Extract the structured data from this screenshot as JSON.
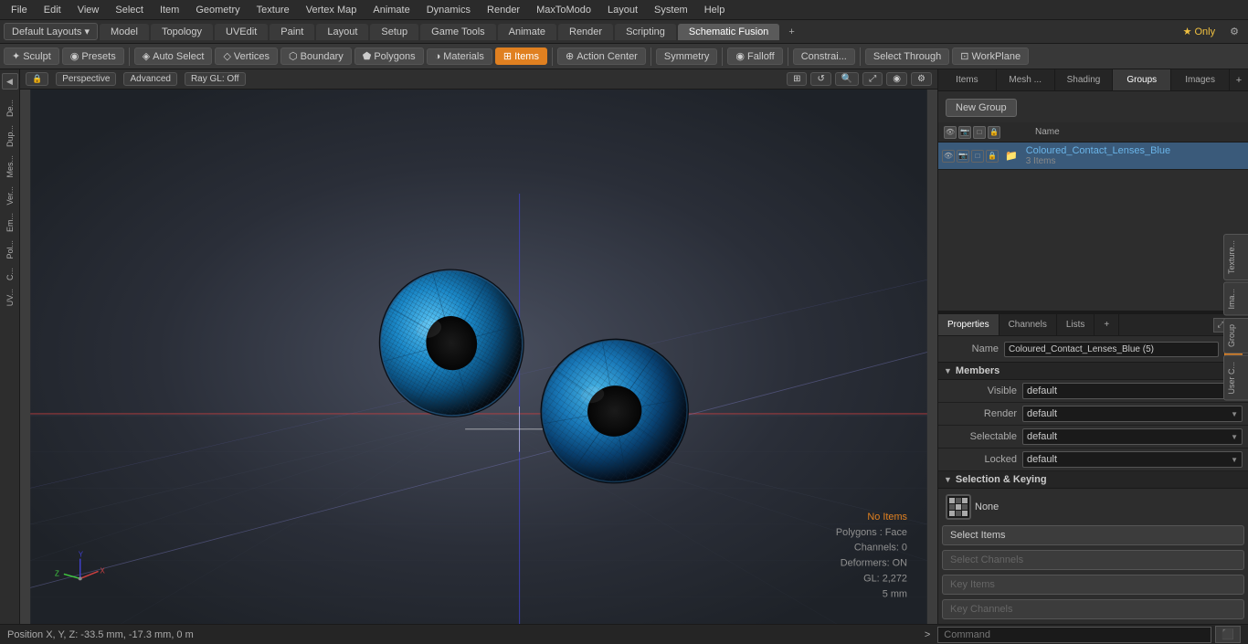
{
  "menubar": {
    "items": [
      "File",
      "Edit",
      "View",
      "Select",
      "Item",
      "Geometry",
      "Texture",
      "Vertex Map",
      "Animate",
      "Dynamics",
      "Render",
      "MaxToModo",
      "Layout",
      "System",
      "Help"
    ]
  },
  "layoutbar": {
    "dropdown": "Default Layouts ▾",
    "tabs": [
      "Model",
      "Topology",
      "UVEdit",
      "Paint",
      "Layout",
      "Setup",
      "Game Tools",
      "Animate",
      "Render",
      "Scripting",
      "Schematic Fusion"
    ],
    "active_tab": "Schematic Fusion",
    "star_label": "★ Only",
    "add_label": "+"
  },
  "toolbar": {
    "sculpt": "Sculpt",
    "presets": "Presets",
    "auto_select": "Auto Select",
    "vertices": "Vertices",
    "boundary": "Boundary",
    "polygons": "Polygons",
    "materials": "Materials",
    "items": "Items",
    "action_center": "Action Center",
    "symmetry": "Symmetry",
    "falloff": "Falloff",
    "constraints": "Constrai...",
    "select_through": "Select Through",
    "workplane": "WorkPlane"
  },
  "viewport": {
    "mode": "Perspective",
    "shading": "Advanced",
    "ray_gl": "Ray GL: Off"
  },
  "status_info": {
    "no_items": "No Items",
    "polygons": "Polygons : Face",
    "channels": "Channels: 0",
    "deformers": "Deformers: ON",
    "gl": "GL: 2,272",
    "mm": "5 mm"
  },
  "coord_bar": {
    "text": "Position X, Y, Z:  -33.5 mm, -17.3 mm, 0 m"
  },
  "right_panel": {
    "tabs": [
      "Items",
      "Mesh ...",
      "Shading",
      "Groups",
      "Images"
    ],
    "active_tab": "Groups",
    "new_group_btn": "New Group",
    "name_col": "Name",
    "group": {
      "name": "Coloured_Contact_Lenses_Blue",
      "sub": "3 Items"
    }
  },
  "properties": {
    "tabs": [
      "Properties",
      "Channels",
      "Lists"
    ],
    "active_tab": "Properties",
    "name_label": "Name",
    "name_value": "Coloured_Contact_Lenses_Blue (5)",
    "members_label": "Members",
    "visible_label": "Visible",
    "visible_value": "default",
    "render_label": "Render",
    "render_value": "default",
    "selectable_label": "Selectable",
    "selectable_value": "default",
    "locked_label": "Locked",
    "locked_value": "default",
    "sel_keying_label": "Selection & Keying",
    "key_icon_label": "None",
    "btn_select_items": "Select Items",
    "btn_select_channels": "Select Channels",
    "btn_key_items": "Key Items",
    "btn_key_channels": "Key Channels"
  },
  "right_edge_tabs": [
    "Texture...",
    "Ima...",
    "Group",
    "User C..."
  ],
  "command_bar": {
    "arrow": ">",
    "placeholder": "Command",
    "btn": "⬛"
  }
}
